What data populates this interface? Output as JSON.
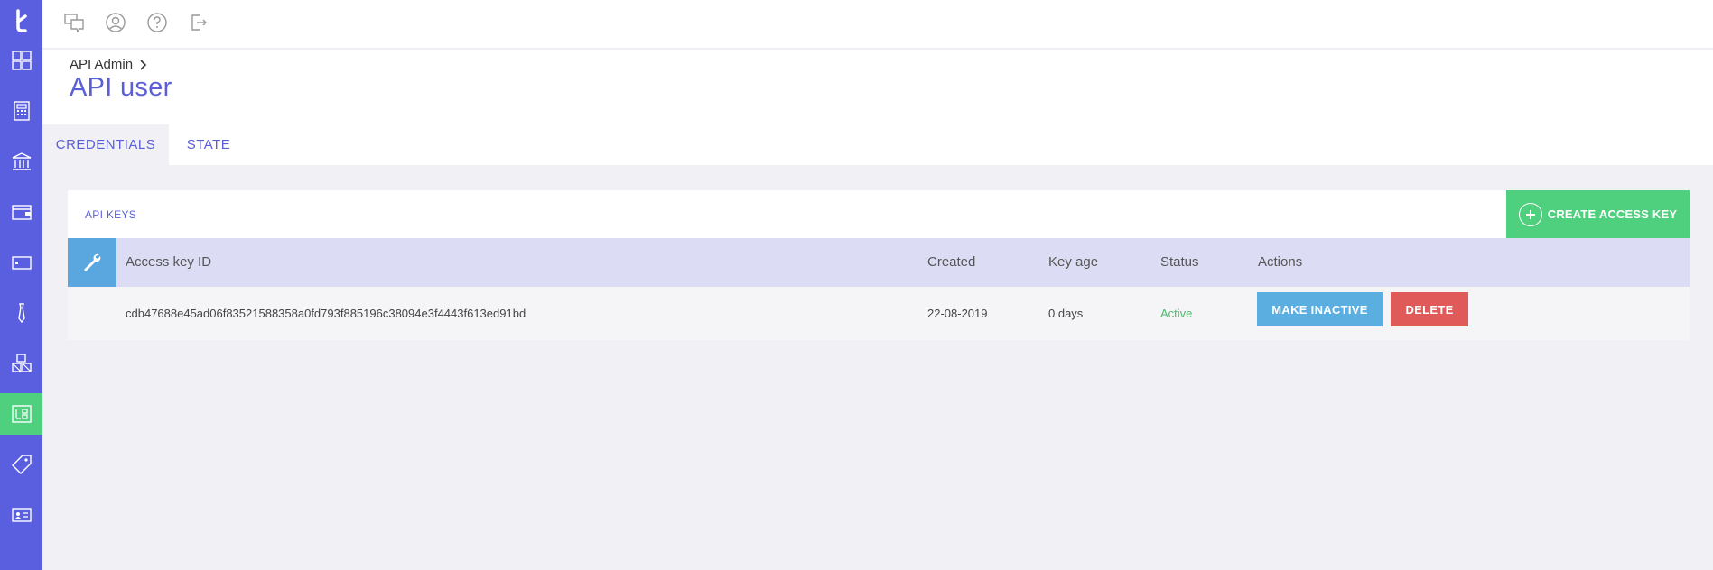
{
  "sidebar": {
    "items": [
      {
        "icon": "dashboard-grid-icon"
      },
      {
        "icon": "calculator-icon"
      },
      {
        "icon": "bank-icon"
      },
      {
        "icon": "wallet-icon"
      },
      {
        "icon": "card-icon"
      },
      {
        "icon": "tie-icon"
      },
      {
        "icon": "boxes-icon"
      },
      {
        "icon": "api-admin-icon",
        "active": true
      },
      {
        "icon": "tag-icon"
      },
      {
        "icon": "id-card-icon"
      }
    ],
    "active_color": "#4fd07e",
    "bg_color": "#5a5fe0"
  },
  "topbar": {
    "icons": [
      "chat-icon",
      "user-circle-icon",
      "help-icon",
      "logout-icon"
    ]
  },
  "breadcrumb": {
    "parent": "API Admin"
  },
  "page": {
    "title": "API user"
  },
  "tabs": [
    {
      "label": "CREDENTIALS",
      "active": true
    },
    {
      "label": "STATE",
      "active": false
    }
  ],
  "panel": {
    "title": "API KEYS",
    "create_button": "CREATE ACCESS KEY"
  },
  "table": {
    "columns": {
      "access_key_id": "Access key ID",
      "created": "Created",
      "key_age": "Key age",
      "status": "Status",
      "actions": "Actions"
    },
    "rows": [
      {
        "access_key_id": "cdb47688e45ad06f83521588358a0fd793f885196c38094e3f4443f613ed91bd",
        "created": "22-08-2019",
        "key_age": "0 days",
        "status": "Active",
        "make_inactive_label": "MAKE INACTIVE",
        "delete_label": "DELETE"
      }
    ]
  },
  "colors": {
    "accent": "#5a5fd6",
    "success": "#4fd07e",
    "info": "#5aaee0",
    "danger": "#e05a5a"
  }
}
